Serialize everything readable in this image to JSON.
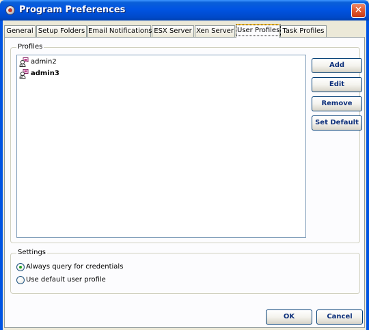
{
  "window": {
    "title": "Program Preferences",
    "close_glyph": "✕"
  },
  "tabs": [
    {
      "label": "General",
      "active": false
    },
    {
      "label": "Setup Folders",
      "active": false
    },
    {
      "label": "Email Notifications",
      "active": false
    },
    {
      "label": "ESX Server",
      "active": false
    },
    {
      "label": "Xen Server",
      "active": false
    },
    {
      "label": "User Profiles",
      "active": true
    },
    {
      "label": "Task Profiles",
      "active": false
    }
  ],
  "profiles": {
    "legend": "Profiles",
    "items": [
      {
        "label": "admin2",
        "bold": false,
        "icon": "user-profile-icon"
      },
      {
        "label": "admin3",
        "bold": true,
        "icon": "user-profile-icon"
      }
    ],
    "buttons": {
      "add": "Add",
      "edit": "Edit",
      "remove": "Remove",
      "set_default": "Set Default"
    }
  },
  "settings": {
    "legend": "Settings",
    "options": [
      {
        "label": "Always query for credentials",
        "selected": true
      },
      {
        "label": "Use default user profile",
        "selected": false
      }
    ]
  },
  "footer": {
    "ok": "OK",
    "cancel": "Cancel"
  },
  "colors": {
    "titlebar": "#0054e3",
    "active_tab_accent": "#ffc83c",
    "button_text": "#0b2e7a",
    "radio_dot": "#21a121"
  }
}
